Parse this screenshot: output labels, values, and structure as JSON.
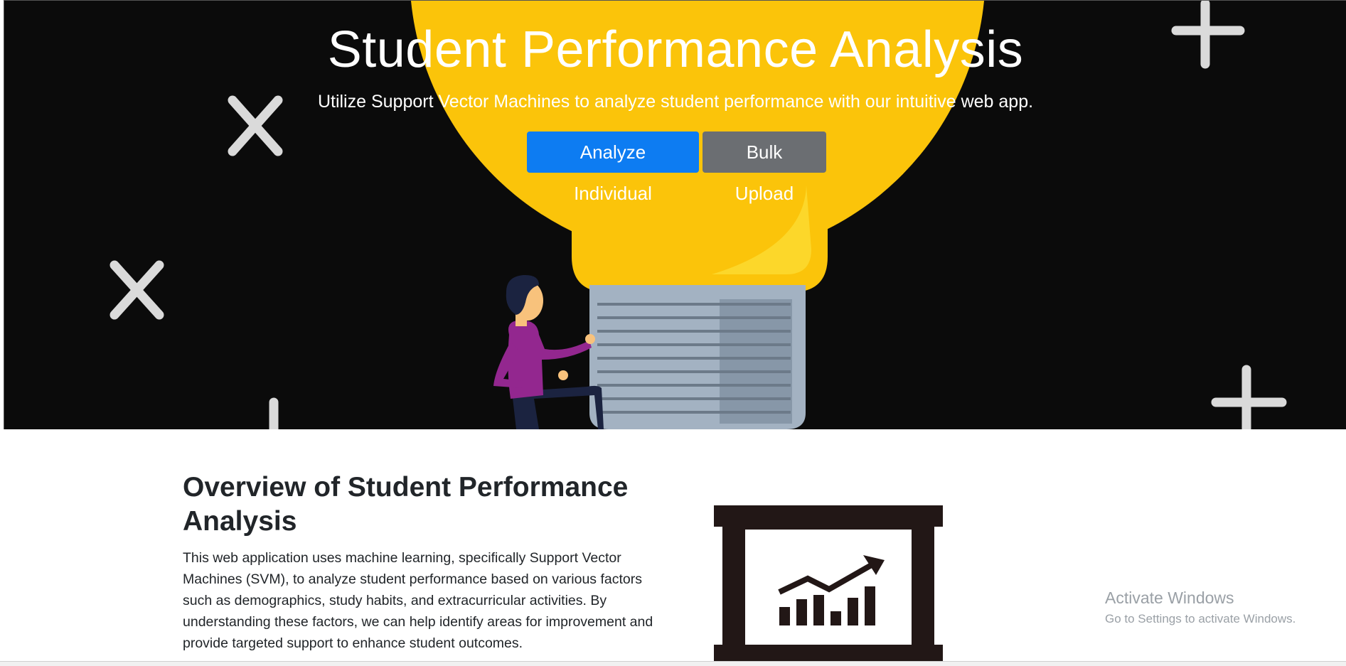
{
  "hero": {
    "title": "Student Performance Analysis",
    "subtitle": "Utilize Support Vector Machines to analyze student performance with our intuitive web app.",
    "buttons": {
      "analyze_individual": "Analyze Individual",
      "bulk_upload": "Bulk Upload"
    },
    "decorations": [
      "x-mark-icon",
      "x-mark-icon",
      "plus-icon",
      "plus-icon",
      "plus-icon"
    ],
    "illustration": "lightbulb-person-illustration"
  },
  "overview": {
    "title": "Overview of Student Performance Analysis",
    "text": "This web application uses machine learning, specifically Support Vector Machines (SVM), to analyze student performance based on various factors such as demographics, study habits, and extracurricular activities. By understanding these factors, we can help identify areas for improvement and provide targeted support to enhance student outcomes.",
    "illustration": "growth-chart-board-icon"
  },
  "watermark": {
    "title": "Activate Windows",
    "subtitle": "Go to Settings to activate Windows."
  },
  "colors": {
    "hero_bg": "#0b0b0b",
    "bulb_yellow": "#fbc40a",
    "primary": "#0d7cf2",
    "secondary": "#6b6e72",
    "text_dark": "#212529"
  }
}
